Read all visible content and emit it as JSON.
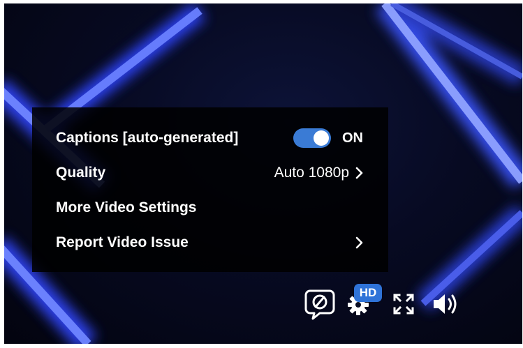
{
  "menu": {
    "captions_label": "Captions [auto-generated]",
    "captions_state": "ON",
    "quality_label": "Quality",
    "quality_value": "Auto 1080p",
    "more_settings_label": "More Video Settings",
    "report_issue_label": "Report Video Issue"
  },
  "controls": {
    "captions_icon": "captions-off-icon",
    "settings_icon": "gear-icon",
    "hd_badge": "HD",
    "fullscreen_icon": "fullscreen-icon",
    "volume_icon": "volume-icon"
  },
  "colors": {
    "accent": "#3a7bd5",
    "hd_badge": "#2f73d8",
    "menu_background": "#000000",
    "neon": "#3b59ff"
  }
}
